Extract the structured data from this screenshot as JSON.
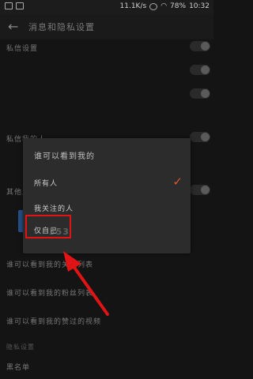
{
  "status_bar": {
    "speed": "11.1K/s",
    "battery": "78%",
    "time": "10:32"
  },
  "header": {
    "title": "消息和隐私设置",
    "back_icon": "arrow-left-icon"
  },
  "settings_rows": {
    "row1": "私信设置",
    "row2": "私信我的人",
    "row3": "其他人",
    "row4": "谁可以看到我的关注列表",
    "row5": "谁可以看到我的粉丝列表",
    "row6": "谁可以看到我的赞过的视频",
    "section": "隐私设置",
    "row7": "黑名单"
  },
  "dialog": {
    "title": "谁可以看到我的",
    "options": [
      {
        "label": "所有人",
        "selected": true
      },
      {
        "label": "我关注的人",
        "selected": false
      },
      {
        "label": "仅自己",
        "selected": false
      }
    ],
    "check_icon": "checkmark-icon"
  },
  "annotations": {
    "highlight_color": "#e01414",
    "arrow_color": "#e01414",
    "watermark": "353"
  }
}
